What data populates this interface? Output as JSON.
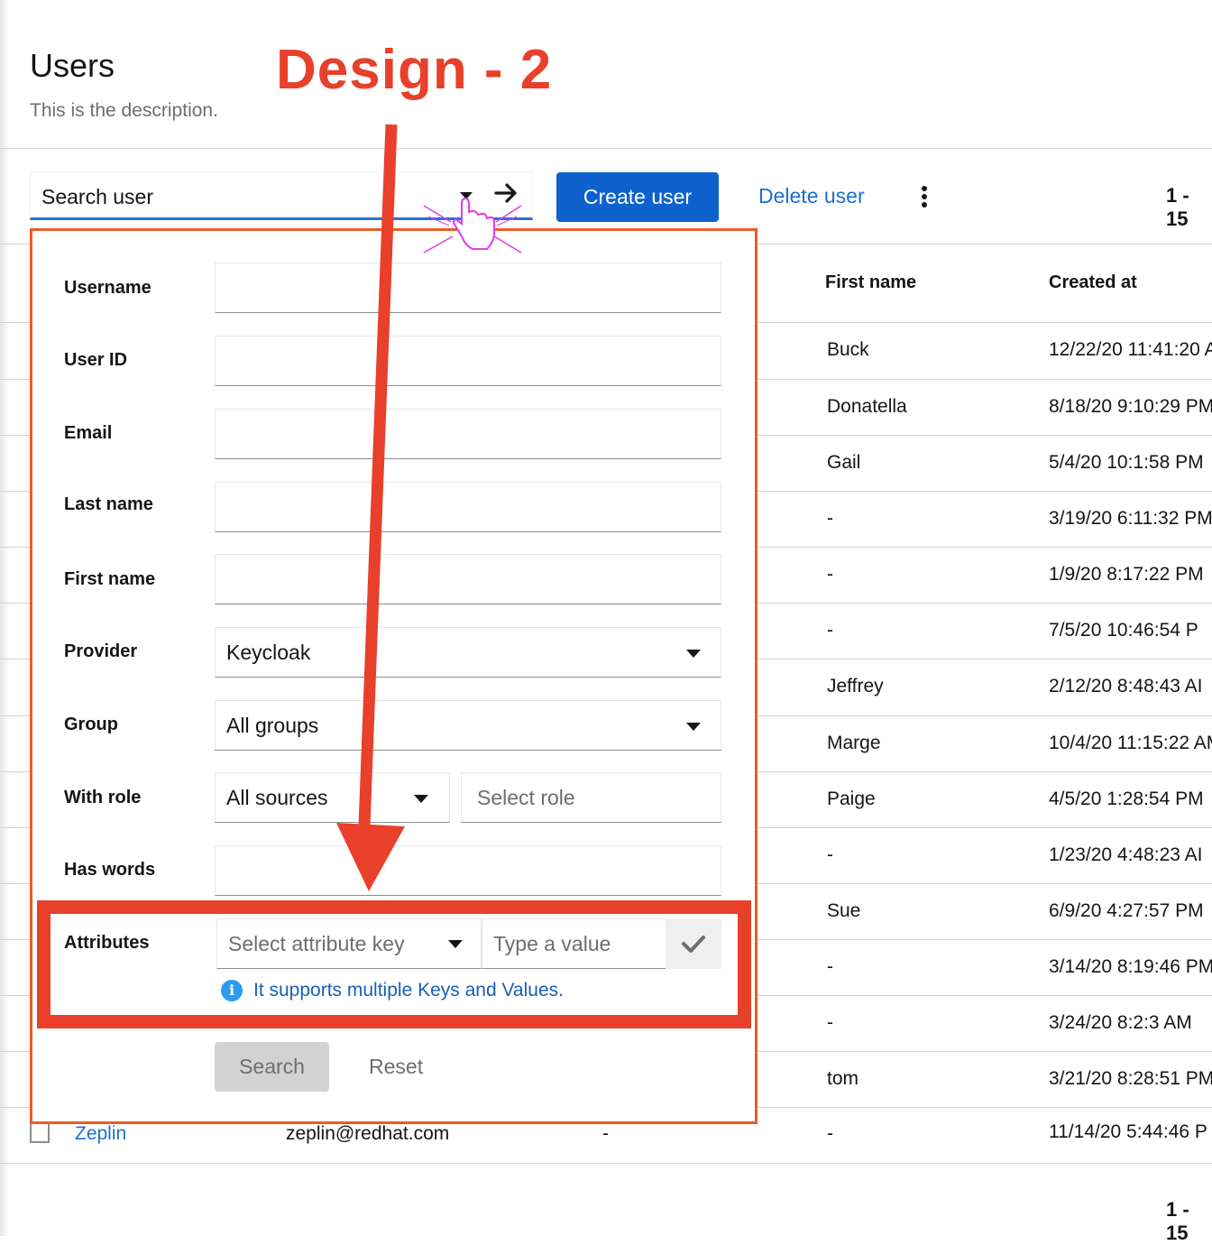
{
  "header": {
    "title": "Users",
    "description": "This is the description.",
    "annotation_title": "Design - 2"
  },
  "toolbar": {
    "search_value": "Search user",
    "create_label": "Create user",
    "delete_label": "Delete user",
    "pagination": "1 - 15"
  },
  "table": {
    "columns": [
      "First name",
      "Created at"
    ],
    "rows": [
      {
        "first_name": "Buck",
        "created_at": "12/22/20 11:41:20 A"
      },
      {
        "first_name": "Donatella",
        "created_at": "8/18/20 9:10:29 PM"
      },
      {
        "first_name": "Gail",
        "created_at": "5/4/20 10:1:58 PM"
      },
      {
        "first_name": "-",
        "created_at": "3/19/20 6:11:32 PM"
      },
      {
        "first_name": "-",
        "created_at": "1/9/20 8:17:22 PM"
      },
      {
        "first_name": "-",
        "created_at": "7/5/20 10:46:54 P"
      },
      {
        "first_name": "Jeffrey",
        "created_at": "2/12/20 8:48:43 AI"
      },
      {
        "first_name": "Marge",
        "created_at": "10/4/20 11:15:22 AM"
      },
      {
        "first_name": "Paige",
        "created_at": "4/5/20 1:28:54 PM"
      },
      {
        "first_name": "-",
        "created_at": "1/23/20 4:48:23 AI"
      },
      {
        "first_name": "Sue",
        "created_at": "6/9/20 4:27:57 PM"
      },
      {
        "first_name": "-",
        "created_at": "3/14/20 8:19:46 PM"
      },
      {
        "first_name": "-",
        "created_at": "3/24/20 8:2:3 AM"
      },
      {
        "first_name": "tom",
        "created_at": "3/21/20 8:28:51 PM"
      }
    ],
    "last_row": {
      "username": "Zeplin",
      "email": "zeplin@redhat.com",
      "last_name": "-",
      "first_name": "-",
      "created_at": "11/14/20 5:44:46 P"
    },
    "pagination_bottom": "1 - 15"
  },
  "filter": {
    "labels": {
      "username": "Username",
      "user_id": "User ID",
      "email": "Email",
      "last_name": "Last name",
      "first_name": "First name",
      "provider": "Provider",
      "group": "Group",
      "with_role": "With role",
      "has_words": "Has words",
      "attributes": "Attributes"
    },
    "provider_value": "Keycloak",
    "group_value": "All groups",
    "role_source_value": "All sources",
    "role_placeholder": "Select role",
    "attr_key_placeholder": "Select attribute key",
    "attr_value_placeholder": "Type a value",
    "info": "It supports multiple Keys and Values.",
    "search_label": "Search",
    "reset_label": "Reset"
  },
  "colors": {
    "primary": "#0e62cd",
    "annotation": "#e8402a",
    "panel_border": "#ee5a24",
    "link": "#1a6fd1"
  }
}
